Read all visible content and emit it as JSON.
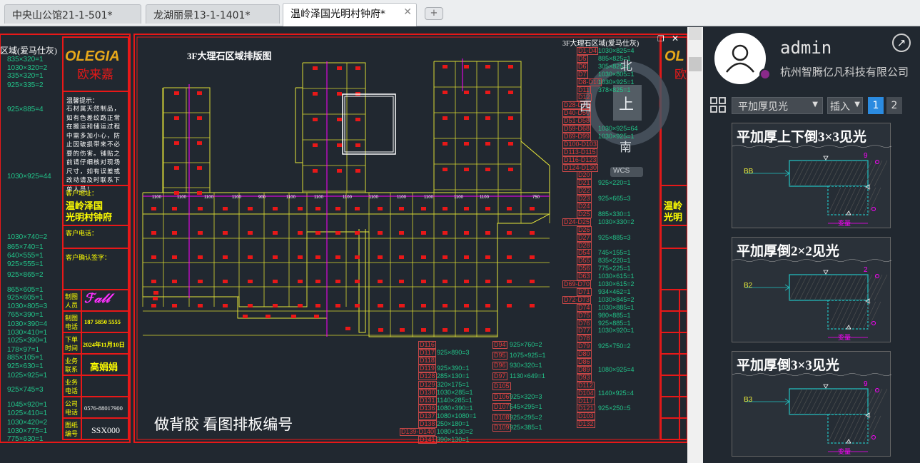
{
  "tabs": [
    {
      "label": "中央山公馆21-1-501*"
    },
    {
      "label": "龙湖丽景13-1-1401*"
    },
    {
      "label": "温岭泽国光明村钟府*",
      "close": "✕"
    }
  ],
  "new_tab_icon": "new-tab-icon",
  "drawing": {
    "title_left_cut": "区域(爱马仕灰)",
    "brand_logo": "OLEGIA",
    "brand_cn": "欧来嘉",
    "notice_title": "温馨提示：",
    "notice_body": "石材属天然制品，如有色差纹路正常在搬运和储运过程中需多加小心，防止因破损带来不必要的伤害。铺贴之前请仔细核对现场尺寸，如有误差或改动请及时联系下单人员！",
    "addr_label": "客户地址：",
    "addr_value1": "温岭泽国",
    "addr_value2": "光明村钟府",
    "phone_label": "客户电话：",
    "confirm_label": "客户确认签字：",
    "maker_label1": "制图",
    "maker_label2": "人员",
    "maker_tel_label1": "制图",
    "maker_tel_label2": "电话",
    "maker_tel": "187 5850 5555",
    "order_label1": "下单",
    "order_label2": "时间",
    "order_time": "2024年11月10日",
    "biz_label1": "业务",
    "biz_label2": "联系",
    "biz_name": "高娟娟",
    "biz_tel1": "业务",
    "biz_tel2": "电话",
    "company_tel1": "公司",
    "company_tel2": "电话",
    "company_tel": "0576-88017900",
    "drawing_no1": "图纸",
    "drawing_no2": "编号",
    "drawing_no": "SSX000",
    "plan_title": "3F大理石区域排版图",
    "top_right_title": "3F大理石区域(爱马仕灰)",
    "bottom_note": "做背胶  看图排板编号",
    "compass": {
      "north": "北",
      "south": "南",
      "west": "西",
      "up": "上",
      "wcs": "WCS"
    },
    "col_dims": [
      "1100",
      "1100",
      "1100",
      "1100",
      "900",
      "1100",
      "1100",
      "1100",
      "1100",
      "1100",
      "1100",
      "1100",
      "1100",
      "750"
    ],
    "left_list": [
      "835×320=1",
      "1030×320=2",
      "335×320=1",
      "925×335=2",
      "925×885=4",
      "1030×925=44",
      "1030×740=2",
      "865×740=1",
      "640×555=1",
      "925×555=1",
      "925×865=2",
      "865×605=1",
      "925×605=1",
      "1030×805=3",
      "765×390=1",
      "1030×390=4",
      "1030×410=1",
      "1025×390=1",
      "178×97=1",
      "885×105=1",
      "925×630=1",
      "1025×925=1",
      "925×745=3",
      "1045×920=1",
      "1025×410=1",
      "1030×420=2",
      "1030×775=1",
      "775×630=1"
    ],
    "right_list": [
      {
        "code": "D1-D4",
        "val": "1030×825=4"
      },
      {
        "code": "D5",
        "val": "885×825=1"
      },
      {
        "code": "D6",
        "val": "305×825=1"
      },
      {
        "code": "D7",
        "val": "1030×805=1"
      },
      {
        "code": "D8-D10",
        "val": "1030×925=1"
      },
      {
        "code": "D11",
        "val": "378×825=1"
      },
      {
        "code": "D12",
        "val": ""
      },
      {
        "code": "D28-D39",
        "val": ""
      },
      {
        "code": "D40-D50",
        "val": ""
      },
      {
        "code": "D51-D58",
        "val": ""
      },
      {
        "code": "D59-D68",
        "val": "1030×925=64"
      },
      {
        "code": "D69-D99",
        "val": "1030×925=1"
      },
      {
        "code": "D100-D103",
        "val": ""
      },
      {
        "code": "D113-D115",
        "val": ""
      },
      {
        "code": "D116-D123",
        "val": ""
      },
      {
        "code": "D124-D130",
        "val": ""
      },
      {
        "code": "D20",
        "val": ""
      },
      {
        "code": "D21",
        "val": "925×220=1"
      },
      {
        "code": "D22",
        "val": ""
      },
      {
        "code": "D23",
        "val": "925×665=3"
      },
      {
        "code": "D24",
        "val": ""
      },
      {
        "code": "D25",
        "val": "885×330=1"
      },
      {
        "code": "D24-D25",
        "val": "1030×330=2"
      },
      {
        "code": "D26",
        "val": ""
      },
      {
        "code": "D27",
        "val": "925×885=3"
      },
      {
        "code": "D28",
        "val": ""
      },
      {
        "code": "D54",
        "val": "745×155=1"
      },
      {
        "code": "D55",
        "val": "835×220=1"
      },
      {
        "code": "D56",
        "val": "775×225=1"
      },
      {
        "code": "D63",
        "val": "1030×615=1"
      },
      {
        "code": "D69-D70",
        "val": "1030×615=2"
      },
      {
        "code": "D71",
        "val": "934×462=1"
      },
      {
        "code": "D72-D73",
        "val": "1030×845=2"
      },
      {
        "code": "D74",
        "val": "1030×885=1"
      },
      {
        "code": "D75",
        "val": "980×885=1"
      },
      {
        "code": "D76",
        "val": "925×885=1"
      },
      {
        "code": "D77",
        "val": "1030×920=1"
      },
      {
        "code": "D78",
        "val": ""
      },
      {
        "code": "D79",
        "val": "925×750=2"
      },
      {
        "code": "D80",
        "val": ""
      },
      {
        "code": "D86",
        "val": ""
      },
      {
        "code": "D89",
        "val": "1080×925=4"
      },
      {
        "code": "D93",
        "val": ""
      },
      {
        "code": "D112",
        "val": ""
      },
      {
        "code": "D104",
        "val": "1140×925=4"
      },
      {
        "code": "D117",
        "val": ""
      },
      {
        "code": "D121",
        "val": "925×250=5"
      },
      {
        "code": "D103",
        "val": ""
      },
      {
        "code": "D132",
        "val": ""
      }
    ],
    "mid_list_a": [
      {
        "code": "D116",
        "val": ""
      },
      {
        "code": "D117",
        "val": "925×890=3"
      },
      {
        "code": "D118",
        "val": ""
      },
      {
        "code": "D119",
        "val": "925×390=1"
      },
      {
        "code": "D128",
        "val": "285×130=1"
      },
      {
        "code": "D129",
        "val": "320×175=1"
      },
      {
        "code": "D130",
        "val": "1030×285=1"
      },
      {
        "code": "D131",
        "val": "1140×285=1"
      },
      {
        "code": "D136",
        "val": "1080×390=1"
      },
      {
        "code": "D137",
        "val": "1080×1080=1"
      },
      {
        "code": "D138",
        "val": "250×180=1"
      },
      {
        "code": "D139-D140",
        "val": "1080×130=2"
      },
      {
        "code": "D141",
        "val": "390×130=1"
      }
    ],
    "mid_list_b": [
      {
        "code": "D94",
        "val": "925×760=2"
      },
      {
        "code": "D95",
        "val": "1075×925=1"
      },
      {
        "code": "D96",
        "val": "930×320=1"
      },
      {
        "code": "D97",
        "val": "1130×649=1"
      },
      {
        "code": "D105",
        "val": ""
      },
      {
        "code": "D106",
        "val": "925×320=3"
      },
      {
        "code": "D107",
        "val": "545×295=1"
      },
      {
        "code": "D108",
        "val": "925×295=2"
      },
      {
        "code": "D109",
        "val": "925×385=1"
      }
    ]
  },
  "panel": {
    "username": "admin",
    "company": "杭州智腾亿凡科技有限公司",
    "expand_icon": "expand-arrow-icon",
    "grid_icon": "grid-view-icon",
    "category_select": "平加厚见光",
    "insert_select": "插入",
    "pages": [
      "1",
      "2"
    ],
    "cards": [
      {
        "title": "平加厚上下倒3×3见光",
        "tag": "BB",
        "dim": "9",
        "foot": "变量"
      },
      {
        "title": "平加厚倒2×2见光",
        "tag": "B2",
        "dim": "2",
        "foot": "变量"
      },
      {
        "title": "平加厚倒3×3见光",
        "tag": "B3",
        "dim": "9",
        "foot": "变量"
      }
    ]
  },
  "colors": {
    "accent": "#2b8be0",
    "canvas": "#212830",
    "red": "#e81818",
    "yellow": "#ffff00",
    "magenta": "#ff00ff",
    "green": "#22c58a"
  }
}
